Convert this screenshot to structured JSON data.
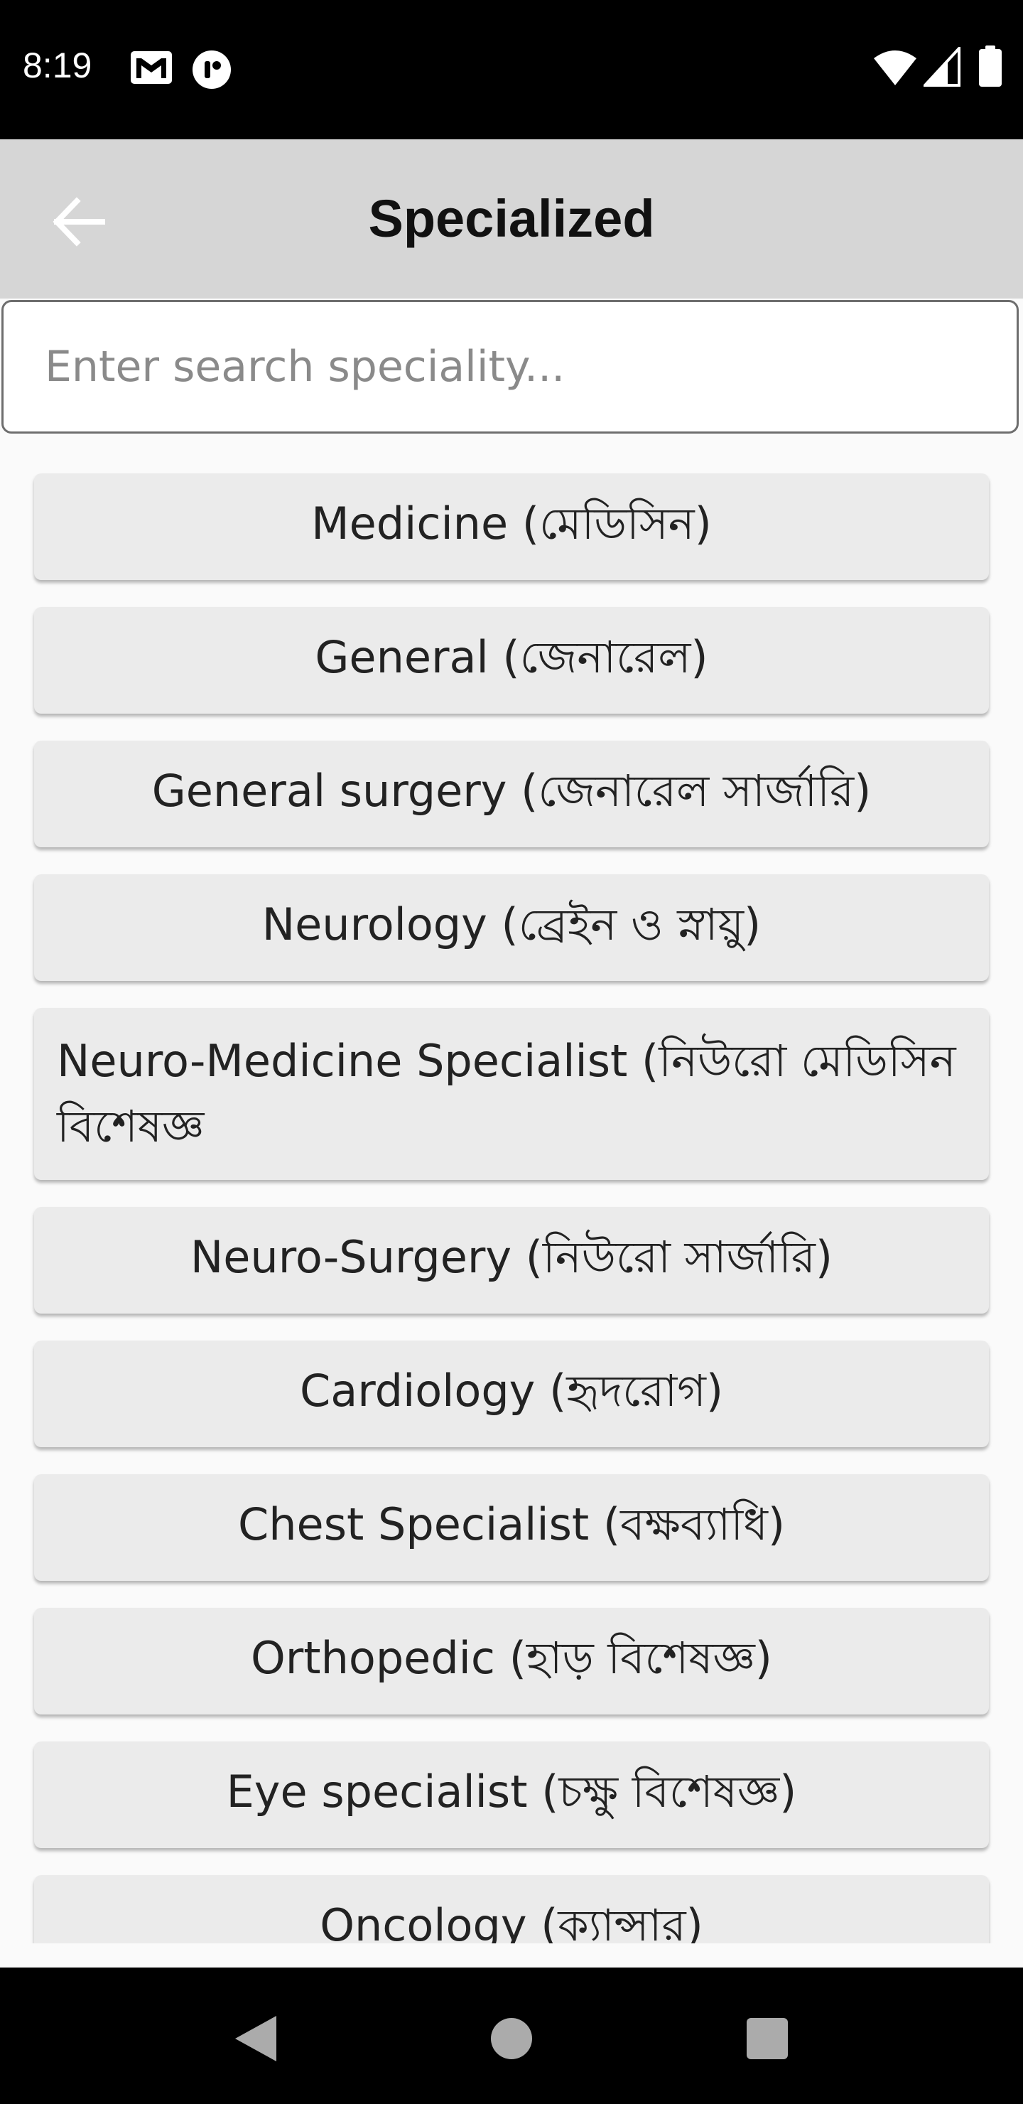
{
  "status_bar": {
    "time": "8:19"
  },
  "header": {
    "title": "Specialized"
  },
  "search": {
    "placeholder": "Enter search speciality..."
  },
  "specialities": [
    "Medicine (মেডিসিন)",
    "General (জেনারেল)",
    "General surgery (জেনারেল সার্জারি)",
    "Neurology (ব্রেইন ও স্নায়ু)",
    "Neuro-Medicine Specialist (নিউরো মেডিসিন বিশেষজ্ঞ",
    "Neuro-Surgery (নিউরো সার্জারি)",
    "Cardiology (হৃদরোগ)",
    "Chest Specialist (বক্ষব্যাধি)",
    "Orthopedic (হাড় বিশেষজ্ঞ)",
    "Eye specialist (চক্ষু বিশেষজ্ঞ)",
    "Oncology (ক্যান্সার)"
  ],
  "colors": {
    "app_bar": "#d6d6d6",
    "item_bg": "#ebebeb",
    "status_bar": "#000000"
  }
}
